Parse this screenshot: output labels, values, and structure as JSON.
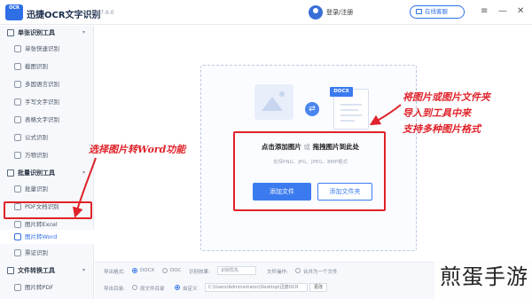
{
  "app": {
    "logo_text": "OCR",
    "title": "迅捷OCR文字识别",
    "version": "v8.7.6.0",
    "login": "登录/注册",
    "online_service": "在线客服",
    "controls": {
      "menu": "≡",
      "minimize": "—",
      "close": "✕"
    }
  },
  "sidebar": {
    "group1": {
      "label": "单张识别工具",
      "chevron": "▾"
    },
    "group1_items": [
      {
        "label": "单张快速识别",
        "icon": "scan-icon"
      },
      {
        "label": "截图识别",
        "icon": "crop-icon"
      },
      {
        "label": "多国语言识别",
        "icon": "globe-icon"
      },
      {
        "label": "手写文字识别",
        "icon": "pen-icon"
      },
      {
        "label": "表格文字识别",
        "icon": "table-icon"
      },
      {
        "label": "公式识别",
        "icon": "formula-icon"
      },
      {
        "label": "万物识别",
        "icon": "leaf-icon"
      }
    ],
    "group2": {
      "label": "批量识别工具",
      "chevron": "▾"
    },
    "group2_items": [
      {
        "label": "批量识别",
        "icon": "batch-icon"
      },
      {
        "label": "PDF文档识别",
        "icon": "pdf-icon"
      },
      {
        "label": "图片转Excel",
        "icon": "excel-icon"
      },
      {
        "label": "图片转Word",
        "icon": "word-icon",
        "active": true
      },
      {
        "label": "票证识别",
        "icon": "ticket-icon"
      }
    ],
    "group3": {
      "label": "文件转换工具",
      "chevron": "▾"
    },
    "group3_items": [
      {
        "label": "图片转PDF",
        "icon": "image-pdf-icon"
      }
    ]
  },
  "main": {
    "docx_tag": "DOCX",
    "drop_title_a": "点击添加图片",
    "drop_title_or": "或",
    "drop_title_b": "拖拽图片到此处",
    "drop_sub": "支持PNG、JPG、JPEG、BMP格式",
    "btn_add_file": "添加文件",
    "btn_add_folder": "添加文件夹"
  },
  "bottom": {
    "export_format_label": "导出格式:",
    "opt_docx": "DOCX",
    "opt_doc": "DOC",
    "recognize_effect_label": "识别效果:",
    "recognize_effect_value": "识别优先",
    "file_op_label": "文件操作:",
    "file_op_value": "合并为一个文件",
    "export_dir_label": "导出目录:",
    "opt_original": "原文件目录",
    "opt_custom": "自定义",
    "path_value": "C:\\Users\\Administrator\\Desktop\\迅捷OCR",
    "change_btn": "更改"
  },
  "annotations": {
    "note1_line1": "将图片或图片文件夹",
    "note1_line2": "导入到工具中来",
    "note1_line3": "支持多种图片格式",
    "note2": "选择图片转Word功能"
  },
  "watermark": "煎蛋手游",
  "colors": {
    "accent": "#3b7bef",
    "annotation": "#e0222a",
    "sidebar_bg": "#f6f8fb"
  }
}
